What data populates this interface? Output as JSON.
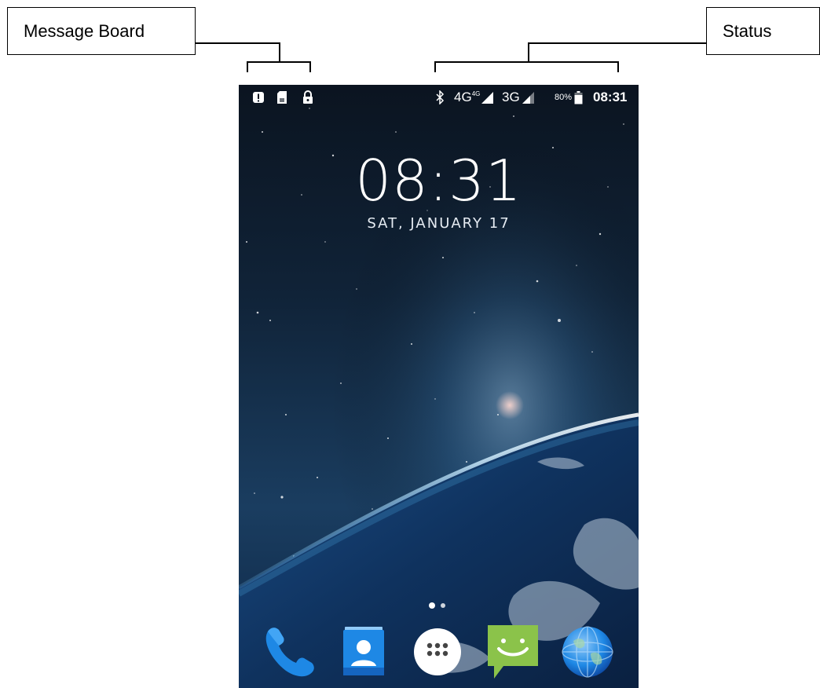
{
  "annotations": {
    "message_board_label": "Message Board",
    "status_label": "Status"
  },
  "status_bar": {
    "left_icons": [
      "alert-icon",
      "sim-card-icon",
      "lock-icon"
    ],
    "bluetooth_icon": "bluetooth-icon",
    "network1": "4G",
    "network1_superscript": "4G",
    "network2": "3G",
    "battery_percent": "80%",
    "time": "08:31"
  },
  "lock_screen": {
    "clock": "08:31",
    "date": "SAT, JANUARY 17"
  },
  "dock": {
    "apps": [
      {
        "name": "phone-app-icon",
        "color": "#1e88e5"
      },
      {
        "name": "contacts-app-icon",
        "color": "#1e88e5"
      },
      {
        "name": "app-drawer-icon",
        "color": "#ffffff"
      },
      {
        "name": "messaging-app-icon",
        "color": "#8bc34a"
      },
      {
        "name": "browser-app-icon",
        "color": "#2196f3"
      }
    ]
  }
}
